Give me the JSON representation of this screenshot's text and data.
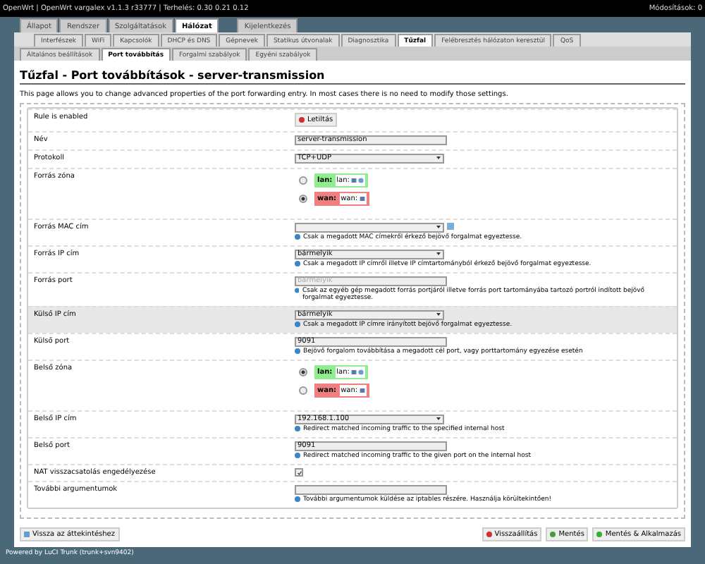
{
  "header": {
    "title": "OpenWrt | OpenWrt vargalex v1.1.3 r33777 | Terhelés: 0.30 0.21 0.12",
    "changes": "Módosítások: 0"
  },
  "main_tabs": [
    {
      "label": "Állapot",
      "selected": false
    },
    {
      "label": "Rendszer",
      "selected": false
    },
    {
      "label": "Szolgáltatások",
      "selected": false
    },
    {
      "label": "Hálózat",
      "selected": true
    },
    {
      "label": "Kijelentkezés",
      "selected": false
    }
  ],
  "sub_tabs": [
    {
      "label": "Interfészek",
      "selected": false
    },
    {
      "label": "WiFi",
      "selected": false
    },
    {
      "label": "Kapcsolók",
      "selected": false
    },
    {
      "label": "DHCP és DNS",
      "selected": false
    },
    {
      "label": "Gépnevek",
      "selected": false
    },
    {
      "label": "Statikus útvonalak",
      "selected": false
    },
    {
      "label": "Diagnosztika",
      "selected": false
    },
    {
      "label": "Tűzfal",
      "selected": true
    },
    {
      "label": "Felébresztés hálózaton keresztül",
      "selected": false
    },
    {
      "label": "QoS",
      "selected": false
    }
  ],
  "section_tabs": [
    {
      "label": "Általános beállítások",
      "selected": false
    },
    {
      "label": "Port továbbítás",
      "selected": true
    },
    {
      "label": "Forgalmi szabályok",
      "selected": false
    },
    {
      "label": "Egyéni szabályok",
      "selected": false
    }
  ],
  "page": {
    "title": "Tűzfal - Port továbbítások - server-transmission",
    "description": "This page allows you to change advanced properties of the port forwarding entry. In most cases there is no need to modify those settings."
  },
  "fields": [
    {
      "kind": "toggle",
      "label": "Rule is enabled",
      "button": "Letiltás"
    },
    {
      "kind": "text",
      "label": "Név",
      "value": "server-transmission"
    },
    {
      "kind": "select",
      "label": "Protokoll",
      "value": "TCP+UDP"
    },
    {
      "kind": "zone",
      "label": "Forrás zóna",
      "options": [
        {
          "zone": "lan:",
          "network": "lan:",
          "color": "#90ee90",
          "selected": false,
          "interfaces": [
            {
              "kind": "ethernet"
            },
            {
              "kind": "wifi"
            }
          ]
        },
        {
          "zone": "wan:",
          "network": "wan:",
          "color": "#f08080",
          "selected": true,
          "interfaces": [
            {
              "kind": "ethernet"
            }
          ]
        }
      ]
    },
    {
      "kind": "select_add",
      "label": "Forrás MAC cím",
      "help": "Csak a megadott MAC címekről érkező bejövő forgalmat egyeztesse."
    },
    {
      "kind": "select",
      "label": "Forrás IP cím",
      "value": "bármelyik",
      "help": "Csak a megadott IP címről illetve IP címtartományból érkező bejövő forgalmat egyeztesse."
    },
    {
      "kind": "text",
      "label": "Forrás port",
      "placeholder": "bármelyik",
      "help": "Csak az egyéb gép megadott forrás portjáról illetve forrás port tartományába tartozó portról indított bejövő forgalmat egyeztesse."
    },
    {
      "kind": "select",
      "label": "Külső IP cím",
      "value": "bármelyik",
      "help": "Csak a megadott IP címre irányított bejövő forgalmat egyeztesse.",
      "highlighted": true
    },
    {
      "kind": "text",
      "label": "Külső port",
      "value": "9091",
      "help": "Bejövő forgalom továbbítása a megadott cél port, vagy porttartomány egyezése esetén"
    },
    {
      "kind": "zone",
      "label": "Belső zóna",
      "options": [
        {
          "zone": "lan:",
          "network": "lan:",
          "color": "#90ee90",
          "selected": true,
          "interfaces": [
            {
              "kind": "ethernet"
            },
            {
              "kind": "wifi"
            }
          ]
        },
        {
          "zone": "wan:",
          "network": "wan:",
          "color": "#f08080",
          "selected": false,
          "interfaces": [
            {
              "kind": "ethernet"
            }
          ]
        }
      ]
    },
    {
      "kind": "select",
      "label": "Belső IP cím",
      "value": "192.168.1.100",
      "help": "Redirect matched incoming traffic to the specified internal host"
    },
    {
      "kind": "text",
      "label": "Belső port",
      "value": "9091",
      "help": "Redirect matched incoming traffic to the given port on the internal host"
    },
    {
      "kind": "checkbox",
      "label": "NAT visszacsatolás engedélyezése",
      "checked": true
    },
    {
      "kind": "text",
      "label": "További argumentumok",
      "help": "További argumentumok küldése az iptables részére. Használja körültekintően!"
    }
  ],
  "back_button": "Vissza az áttekintéshez",
  "actions": [
    {
      "kind": "reset",
      "label": "Visszaállítás"
    },
    {
      "kind": "save",
      "label": "Mentés"
    },
    {
      "kind": "apply",
      "label": "Mentés & Alkalmazás"
    }
  ],
  "footer": "Powered by LuCI Trunk (trunk+svn9402)"
}
